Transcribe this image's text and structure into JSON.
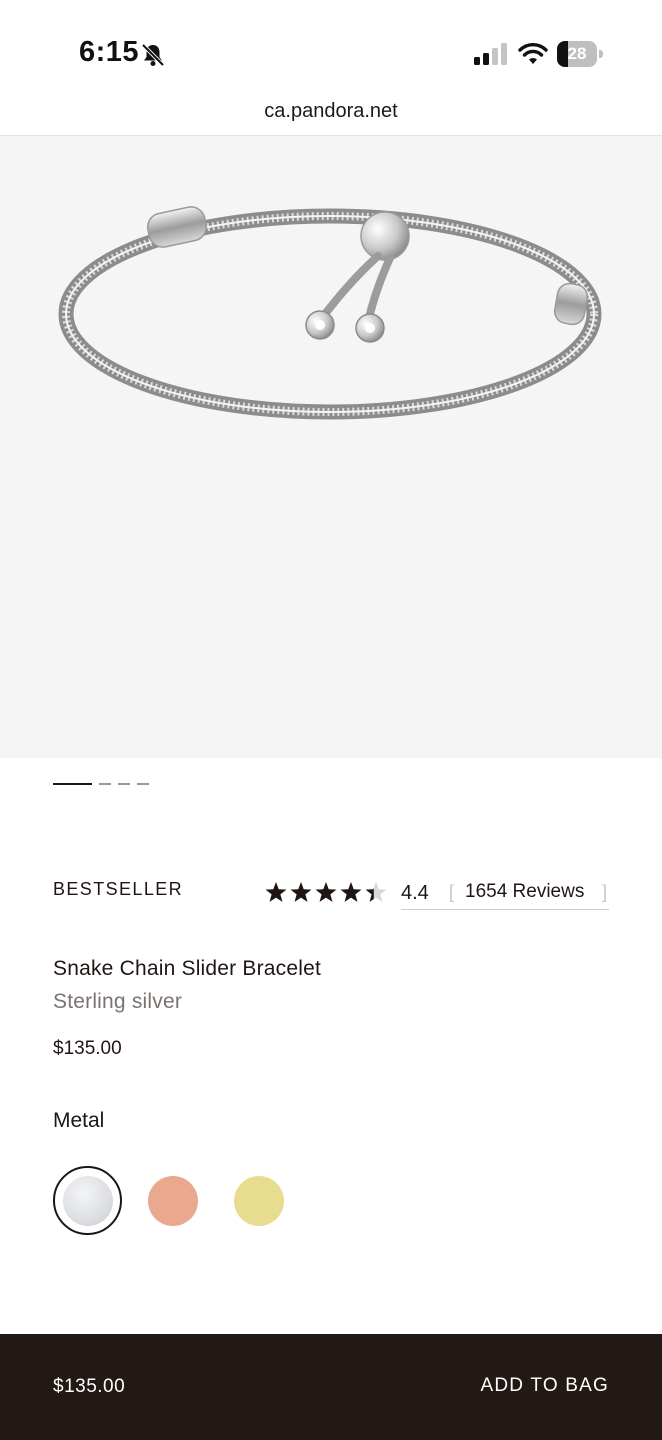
{
  "status_bar": {
    "time": "6:15",
    "battery_level": "28",
    "battery_fraction": 0.28,
    "icons": [
      "bell-slash-icon",
      "cellular-signal-icon",
      "wifi-icon",
      "battery-icon"
    ]
  },
  "browser": {
    "url": "ca.pandora.net"
  },
  "gallery": {
    "image_count": 4,
    "active_index": 0
  },
  "product": {
    "badge": "BESTSELLER",
    "rating_value": "4.4",
    "rating_stars": 4.4,
    "review_count_label": "1654 Reviews",
    "bracket_open": "[",
    "bracket_close": "]",
    "name": "Snake Chain Slider Bracelet",
    "material": "Sterling silver",
    "price": "$135.00",
    "metal_label": "Metal",
    "metal_options": [
      {
        "name": "silver",
        "color": "#d8dade",
        "selected": true
      },
      {
        "name": "rose-gold",
        "color": "#eaa98f",
        "selected": false
      },
      {
        "name": "gold",
        "color": "#e8dc8e",
        "selected": false
      }
    ]
  },
  "bottom_bar": {
    "price": "$135.00",
    "add_to_bag_label": "ADD TO BAG"
  },
  "colors": {
    "text_dark": "#1f1614",
    "text_muted": "#7a7370",
    "bottom_bar_bg": "#221915",
    "hero_bg": "#f5f5f5"
  }
}
